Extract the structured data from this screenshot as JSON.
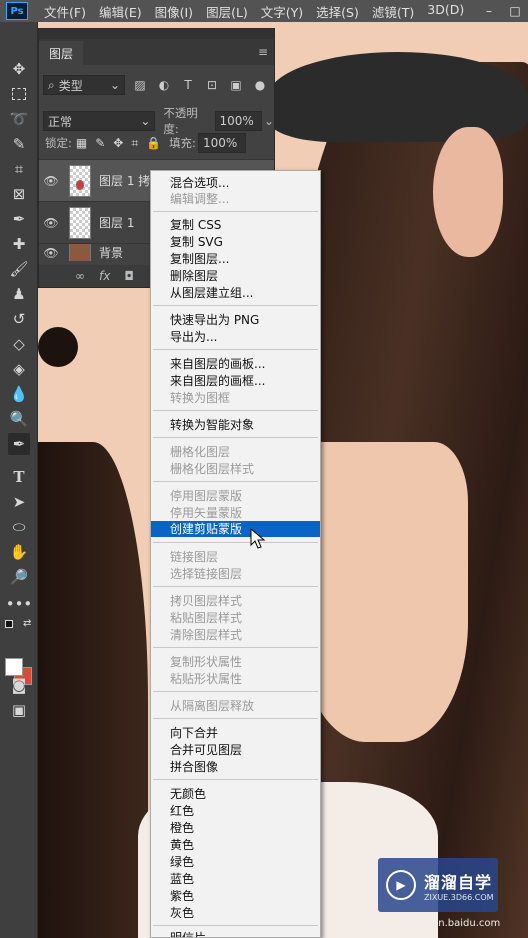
{
  "menubar": {
    "logo": "Ps",
    "items": [
      "文件(F)",
      "编辑(E)",
      "图像(I)",
      "图层(L)",
      "文字(Y)",
      "选择(S)",
      "滤镜(T)",
      "3D(D)"
    ],
    "window_controls": [
      "–",
      "□"
    ]
  },
  "layers_panel": {
    "tab": "图层",
    "filter_label": "类型",
    "blend_mode": "正常",
    "opacity_label": "不透明度:",
    "opacity_value": "100%",
    "lock_label": "锁定:",
    "fill_label": "填充:",
    "fill_value": "100%",
    "layers": [
      {
        "name": "图层 1 拷"
      },
      {
        "name": "图层 1"
      },
      {
        "name": "背景"
      }
    ],
    "bottom_icons": [
      "∞",
      "fx",
      "◘"
    ]
  },
  "context_menu": {
    "items": [
      {
        "label": "混合选项...",
        "disabled": false
      },
      {
        "label": "编辑调整...",
        "disabled": true
      },
      {
        "label": "复制 CSS",
        "disabled": false
      },
      {
        "label": "复制 SVG",
        "disabled": false
      },
      {
        "label": "复制图层...",
        "disabled": false
      },
      {
        "label": "删除图层",
        "disabled": false
      },
      {
        "label": "从图层建立组...",
        "disabled": false
      },
      {
        "label": "快速导出为 PNG",
        "disabled": false
      },
      {
        "label": "导出为...",
        "disabled": false
      },
      {
        "label": "来自图层的画板...",
        "disabled": false
      },
      {
        "label": "来自图层的画框...",
        "disabled": false
      },
      {
        "label": "转换为图框",
        "disabled": true
      },
      {
        "label": "转换为智能对象",
        "disabled": false
      },
      {
        "label": "栅格化图层",
        "disabled": true
      },
      {
        "label": "栅格化图层样式",
        "disabled": true
      },
      {
        "label": "停用图层蒙版",
        "disabled": true
      },
      {
        "label": "停用矢量蒙版",
        "disabled": true
      },
      {
        "label": "创建剪贴蒙版",
        "disabled": false,
        "highlighted": true
      },
      {
        "label": "链接图层",
        "disabled": true
      },
      {
        "label": "选择链接图层",
        "disabled": true
      },
      {
        "label": "拷贝图层样式",
        "disabled": true
      },
      {
        "label": "粘贴图层样式",
        "disabled": true
      },
      {
        "label": "清除图层样式",
        "disabled": true
      },
      {
        "label": "复制形状属性",
        "disabled": true
      },
      {
        "label": "粘贴形状属性",
        "disabled": true
      },
      {
        "label": "从隔离图层释放",
        "disabled": true
      },
      {
        "label": "向下合并",
        "disabled": false
      },
      {
        "label": "合并可见图层",
        "disabled": false
      },
      {
        "label": "拼合图像",
        "disabled": false
      },
      {
        "label": "无颜色",
        "disabled": false
      },
      {
        "label": "红色",
        "disabled": false
      },
      {
        "label": "橙色",
        "disabled": false
      },
      {
        "label": "黄色",
        "disabled": false
      },
      {
        "label": "绿色",
        "disabled": false
      },
      {
        "label": "蓝色",
        "disabled": false
      },
      {
        "label": "紫色",
        "disabled": false
      },
      {
        "label": "灰色",
        "disabled": false
      },
      {
        "label": "明信片",
        "disabled": false
      }
    ]
  },
  "watermark": {
    "title": "溜溜自学",
    "url": "ZIXUE.3D66.COM",
    "sub": "jingyan.baidu.com"
  },
  "colors": {
    "highlight": "#0a64c8",
    "foreground_swatch": "#ffffff",
    "background_swatch": "#d84a3a"
  }
}
